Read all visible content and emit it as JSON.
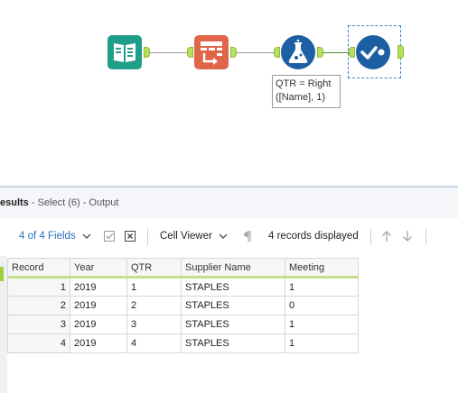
{
  "canvas": {
    "formula_annotation": {
      "line1": "QTR = Right",
      "line2": "([Name], 1)"
    }
  },
  "results": {
    "title": "esults",
    "subtitle": "- Select (6) - Output",
    "toolbar": {
      "fields_label": "4 of 4 Fields",
      "cell_viewer_label": "Cell Viewer",
      "records_displayed": "4 records displayed"
    },
    "columns": [
      "Record",
      "Year",
      "QTR",
      "Supplier Name",
      "Meeting"
    ],
    "rows": [
      {
        "record": "1",
        "year": "2019",
        "qtr": "1",
        "supplier": "STAPLES",
        "meeting": "1"
      },
      {
        "record": "2",
        "year": "2019",
        "qtr": "2",
        "supplier": "STAPLES",
        "meeting": "0"
      },
      {
        "record": "3",
        "year": "2019",
        "qtr": "3",
        "supplier": "STAPLES",
        "meeting": "1"
      },
      {
        "record": "4",
        "year": "2019",
        "qtr": "4",
        "supplier": "STAPLES",
        "meeting": "1"
      }
    ]
  },
  "colors": {
    "input_tool": "#1f9e8a",
    "sort_tool": "#e0664a",
    "formula_tool": "#1d5fa3",
    "select_tool": "#1d5fa3",
    "anchor": "#b7e05d",
    "link": "#2a6ebb"
  },
  "icons": [
    "input-data-book-icon",
    "sort-table-icon",
    "formula-flask-icon",
    "select-check-icon",
    "checkbox-icon",
    "close-box-icon",
    "chevron-down-icon",
    "pilcrow-icon",
    "arrow-up-icon",
    "arrow-down-icon"
  ]
}
